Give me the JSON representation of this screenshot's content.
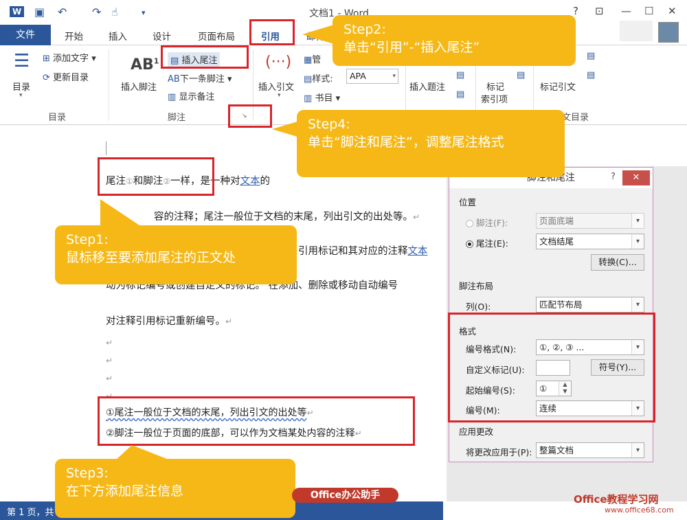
{
  "titlebar": {
    "doc_title": "文档1 - Word",
    "help": "?",
    "minimize": "—",
    "maximize": "☐",
    "close": "✕"
  },
  "tabs": {
    "file": "文件",
    "home": "开始",
    "insert": "插入",
    "design": "设计",
    "layout": "页面布局",
    "references": "引用",
    "mailings": "邮件"
  },
  "ribbon": {
    "toc": "目录",
    "add_text": "添加文字",
    "update_toc": "更新目录",
    "group_toc": "目录",
    "insert_footnote": "插入脚注",
    "insert_endnote": "插入尾注",
    "next_footnote": "下一条脚注",
    "show_notes": "显示备注",
    "group_footnote": "脚注",
    "insert_citation": "插入引文",
    "manage_sources": "管",
    "style_label": "样式:",
    "style_value": "APA",
    "bibliography": "书目",
    "insert_caption": "插入题注",
    "mark_entry_1": "标记",
    "mark_entry_2": "索引项",
    "mark_citation": "标记引文",
    "group_toa": "文目录"
  },
  "doc": {
    "line1_a": "尾注",
    "line1_sup1": "①",
    "line1_b": "和脚注",
    "line1_sup2": "②",
    "line1_c": "一样，是一种对",
    "line1_link": "文本",
    "line1_d": "的",
    "line2": "容的注释；尾注一般位于文档的末尾，列出引文的出处等。",
    "line3_a": "引用标记和其对应的注释",
    "line3_link": "文本",
    "line4_a": "动为标记编号或创建自定义的标记。",
    "line4_b": "在添加、删除或移动自动编号",
    "line5": "对注释引用标记重新编号。",
    "para": "↵",
    "note1": "①尾注一般位于文档的末尾，列出引文的出处等",
    "note2": "②脚注一般位于页面的底部，可以作为文档某处内容的注释"
  },
  "status": {
    "page": "第 1 页，共"
  },
  "dialog": {
    "title": "脚注和尾注",
    "help": "?",
    "close": "✕",
    "position": "位置",
    "footnote": "脚注(F):",
    "footnote_value": "页面底端",
    "endnote": "尾注(E):",
    "endnote_value": "文档结尾",
    "convert": "转换(C)...",
    "layout": "脚注布局",
    "columns": "列(O):",
    "columns_value": "匹配节布局",
    "format": "格式",
    "number_format": "编号格式(N):",
    "number_format_value": "①, ②, ③ ...",
    "custom_mark": "自定义标记(U):",
    "symbol": "符号(Y)...",
    "start_at": "起始编号(S):",
    "start_at_value": "①",
    "numbering": "编号(M):",
    "numbering_value": "连续",
    "apply_changes": "应用更改",
    "apply_to": "将更改应用于(P):",
    "apply_to_value": "整篇文档"
  },
  "callouts": {
    "step1_title": "Step1:",
    "step1_text": "鼠标移至要添加尾注的正文处",
    "step2_title": "Step2:",
    "step2_text": "单击“引用”-“插入尾注”",
    "step3_title": "Step3:",
    "step3_text": "在下方添加尾注信息",
    "step4_title": "Step4:",
    "step4_text": "单击“脚注和尾注”，调整尾注格式"
  },
  "watermark": {
    "badge": "Office办公助手",
    "site": "Office教程学习网",
    "url": "www.office68.com"
  },
  "colors": {
    "word_blue": "#2b579a",
    "callout": "#f6b816",
    "highlight": "#d9232a"
  }
}
